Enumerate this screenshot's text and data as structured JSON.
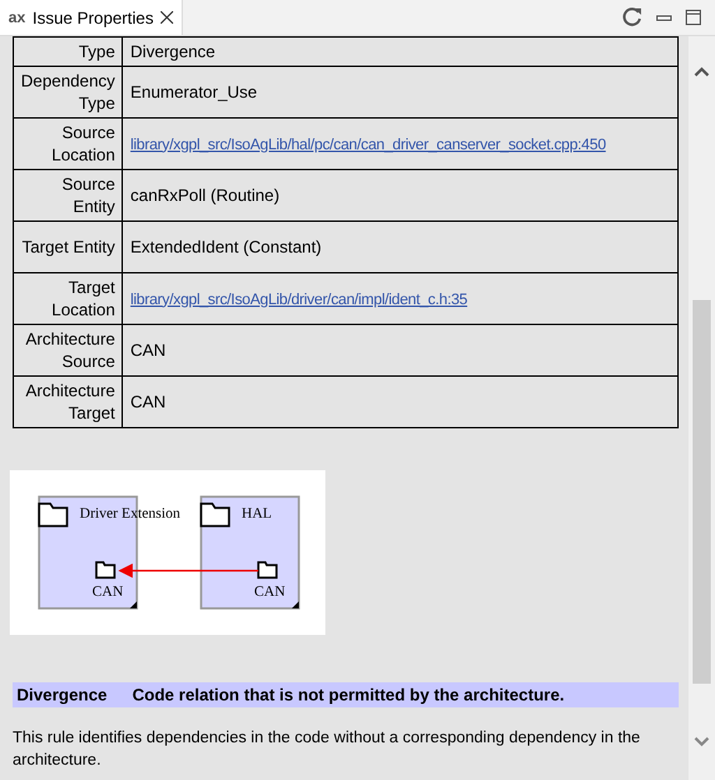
{
  "tab": {
    "logo": "ax",
    "title": "Issue Properties",
    "selected": true
  },
  "properties": [
    {
      "label": "Type",
      "value": "Divergence",
      "kind": "text"
    },
    {
      "label": "Dependency Type",
      "value": "Enumerator_Use",
      "kind": "text"
    },
    {
      "label": "Source Location",
      "value": "library/xgpl_src/IsoAgLib/hal/pc/can/can_driver_canserver_socket.cpp:450",
      "kind": "link"
    },
    {
      "label": "Source Entity",
      "value": "canRxPoll (Routine)",
      "kind": "text"
    },
    {
      "label": "Target Entity",
      "value": "ExtendedIdent (Constant)",
      "kind": "text"
    },
    {
      "label": "Target Location",
      "value": "library/xgpl_src/IsoAgLib/driver/can/impl/ident_c.h:35",
      "kind": "link"
    },
    {
      "label": "Architecture Source",
      "value": "CAN",
      "kind": "text"
    },
    {
      "label": "Architecture Target",
      "value": "CAN",
      "kind": "text"
    }
  ],
  "diagram": {
    "components": [
      {
        "name": "Driver Extension",
        "child": "CAN"
      },
      {
        "name": "HAL",
        "child": "CAN"
      }
    ]
  },
  "rule": {
    "name": "Divergence",
    "summary": "Code relation that is not permitted by the architecture.",
    "description": "This rule identifies dependencies in the code without a corresponding dependency in the architecture."
  }
}
